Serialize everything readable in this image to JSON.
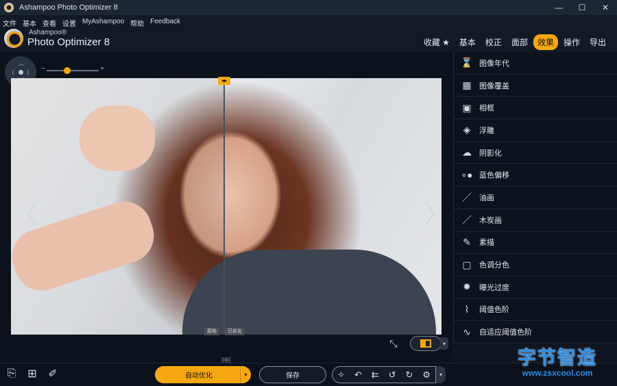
{
  "window": {
    "title": "Ashampoo Photo Optimizer 8",
    "controls": {
      "minimize": "—",
      "maximize": "☐",
      "close": "✕"
    }
  },
  "menu": [
    "文件",
    "基本",
    "查看",
    "设置",
    "MyAshampoo",
    "帮助",
    "Feedback"
  ],
  "brand": {
    "small": "Ashampoo®",
    "big": "Photo Optimizer 8"
  },
  "topnav": {
    "items": [
      "收藏 ★",
      "基本",
      "校正",
      "面部",
      "效果",
      "操作",
      "导出"
    ],
    "active": "效果"
  },
  "viewer": {
    "split_labels": {
      "before": "原始",
      "after": "已优化"
    },
    "prev_arrow": "〈",
    "next_arrow": "〉",
    "zoom_level": 0.4
  },
  "effects": [
    {
      "icon": "hourglass-icon",
      "glyph": "⌛",
      "label": "图像年代"
    },
    {
      "icon": "image-overlay-icon",
      "glyph": "▦",
      "label": "图像覆盖"
    },
    {
      "icon": "frame-icon",
      "glyph": "▣",
      "label": "相框"
    },
    {
      "icon": "emboss-icon",
      "glyph": "◈",
      "label": "浮雕"
    },
    {
      "icon": "shadow-icon",
      "glyph": "☁",
      "label": "阴影化"
    },
    {
      "icon": "blue-shift-icon",
      "glyph": "∘●",
      "label": "蓝色偏移"
    },
    {
      "icon": "brush-icon",
      "glyph": "／",
      "label": "油画"
    },
    {
      "icon": "charcoal-icon",
      "glyph": "／",
      "label": "木炭画"
    },
    {
      "icon": "pencil-icon",
      "glyph": "✎",
      "label": "素描"
    },
    {
      "icon": "tone-icon",
      "glyph": "▢",
      "label": "色调分色"
    },
    {
      "icon": "overexposure-icon",
      "glyph": "✹",
      "label": "曝光过度"
    },
    {
      "icon": "threshold-icon",
      "glyph": "⌇",
      "label": "阈值色阶"
    },
    {
      "icon": "adaptive-threshold-icon",
      "glyph": "∿",
      "label": "自适应阈值色阶"
    }
  ],
  "bottom": {
    "auto_optimize": "自动优化",
    "save": "保存"
  },
  "watermark": {
    "cn": "字节智造",
    "url": "www.zsxcool.com"
  },
  "colors": {
    "accent": "#f5a712",
    "panel": "#0d131c",
    "watermark": "#2a8ee6"
  }
}
